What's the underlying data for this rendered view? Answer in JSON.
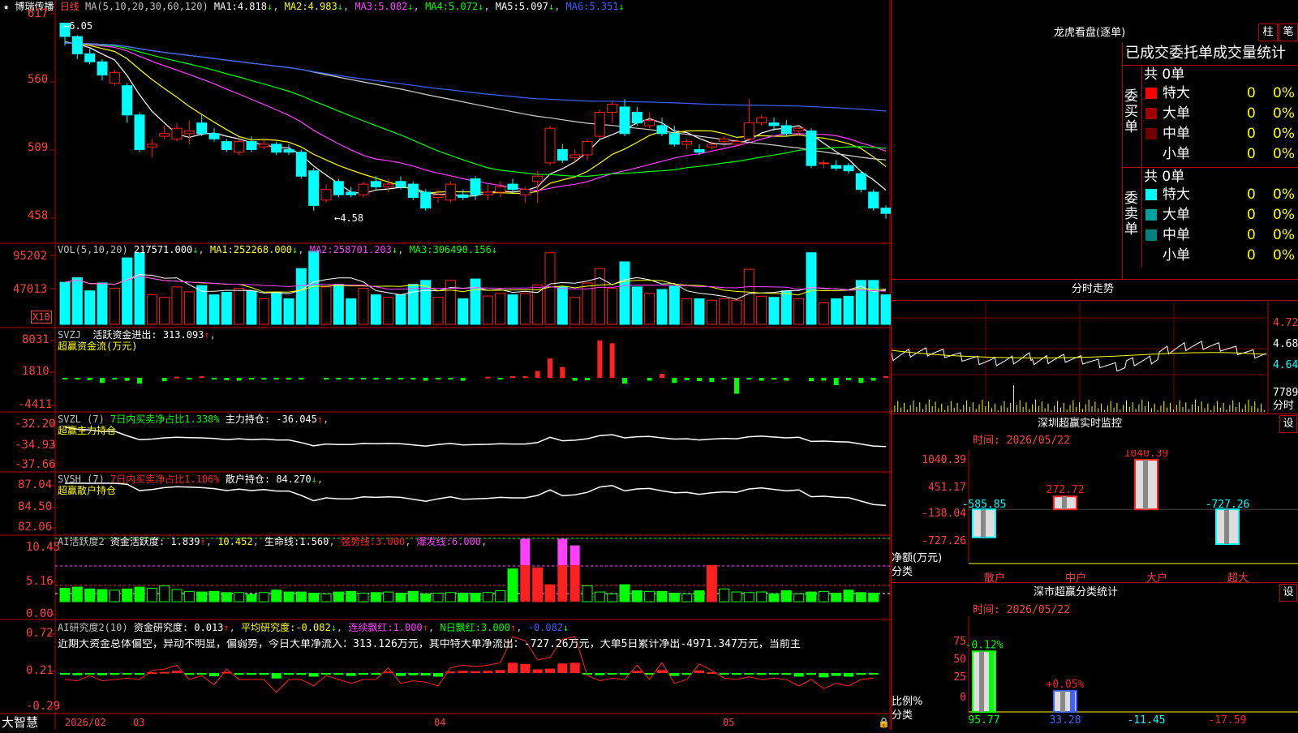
{
  "colors": {
    "up": "#ff2020",
    "down": "#00ffff",
    "frame": "#c00000",
    "yellow": "#ffff00",
    "magenta": "#ff40ff",
    "green": "#00ff00",
    "white": "#ffffff",
    "gray": "#c0c0c0",
    "blue": "#4060ff",
    "label": "#ff4040"
  },
  "price_panel": {
    "name": "博瑞传播",
    "period": "日线",
    "ma_spec": "MA(5,10,20,30,60,120)",
    "ma_values": [
      {
        "label": "MA1:",
        "value": "4.818"
      },
      {
        "label": "MA2:",
        "value": "4.983"
      },
      {
        "label": "MA3:",
        "value": "5.082"
      },
      {
        "label": "MA4:",
        "value": "5.072"
      },
      {
        "label": "MA5:",
        "value": "5.097"
      },
      {
        "label": "MA6:",
        "value": "5.351"
      }
    ],
    "axis_labels": [
      "617",
      "560",
      "509",
      "458"
    ],
    "high_mark": "6.05",
    "low_mark": "4.58"
  },
  "vol_panel": {
    "spec": "VOL(5,10,20)",
    "value": "217571.000",
    "ma": [
      {
        "label": "MA1:",
        "value": "252268.000"
      },
      {
        "label": "MA2:",
        "value": "258701.203"
      },
      {
        "label": "MA3:",
        "value": "306490.156"
      }
    ],
    "axis_labels": [
      "95202",
      "47013"
    ],
    "unit": "X10"
  },
  "svzj_panel": {
    "spec": "SVZJ",
    "label": "活跃资金进出:",
    "value": "313.093",
    "subtitle": "超赢资金流(万元)",
    "axis_labels": [
      "8031",
      "1810",
      "-4411"
    ]
  },
  "svzl_panel": {
    "spec": "SVZL (7)",
    "ratio_text": "7日内买卖净占比1.338%",
    "label": "主力持仓:",
    "value": "-36.045",
    "subtitle": "超赢主力持仓",
    "axis_labels": [
      "-32.20",
      "-34.93",
      "-37.66"
    ]
  },
  "svsh_panel": {
    "spec": "SVSH (7)",
    "ratio_text": "7日内买卖净占比1.106%",
    "label": "散户持仓:",
    "value": "84.270",
    "subtitle": "超赢散户持仓",
    "axis_labels": [
      "87.04",
      "84.50",
      "82.06"
    ]
  },
  "ai_panel": {
    "spec": "AI活跃度2",
    "label": "资金活跃度:",
    "value": "1.839",
    "v2": "10.452",
    "life_label": "生命线:",
    "life_value": "1.560",
    "strong_label": "强势线:",
    "strong_value": "3.000",
    "burst_label": "爆发线:",
    "burst_value": "6.000",
    "axis_labels": [
      "10.45",
      "5.16",
      "0.00"
    ]
  },
  "ai_research": {
    "spec": "AI研究度2(10)",
    "label": "资金研究度:",
    "value": "0.013",
    "avg_label": "平均研究度:",
    "avg_value": "-0.082",
    "cont_label": "连续飘红:",
    "cont_value": "1.000",
    "n_label": "N日飘红:",
    "n_value": "3.000",
    "last_value": "-0.082",
    "summary": "近期大资金总体偏空，异动不明显，偏弱势，今日大单净流入：313.126万元，其中特大单净流出：-727.26万元，大单5日累计净出-4971.347万元，当前主",
    "axis_labels": [
      "0.72",
      "0.21",
      "-0.29"
    ]
  },
  "bottom_axis": {
    "brand": "大智慧",
    "dates": [
      "2026/02",
      "03",
      "04",
      "05"
    ]
  },
  "right": {
    "dragon_title": "龙虎看盘(逐单)",
    "tab_zhu": "柱",
    "tab_bi": "笔",
    "stats_title": "已成交委托单成交量统计",
    "buy_side": "委买单",
    "sell_side": "委卖单",
    "buy_total": "共 0单",
    "sell_total": "共 0单",
    "buy_rows": [
      {
        "label": "特大",
        "count": "0",
        "pct": "0%",
        "color": "#ff0000"
      },
      {
        "label": "大单",
        "count": "0",
        "pct": "0%",
        "color": "#a00000"
      },
      {
        "label": "中单",
        "count": "0",
        "pct": "0%",
        "color": "#700000"
      },
      {
        "label": "小单",
        "count": "0",
        "pct": "0%",
        "color": "#000000"
      }
    ],
    "sell_rows": [
      {
        "label": "特大",
        "count": "0",
        "pct": "0%",
        "color": "#00ffff"
      },
      {
        "label": "大单",
        "count": "0",
        "pct": "0%",
        "color": "#00a0a0"
      },
      {
        "label": "中单",
        "count": "0",
        "pct": "0%",
        "color": "#008080"
      },
      {
        "label": "小单",
        "count": "0",
        "pct": "0%",
        "color": "#000000"
      }
    ],
    "intraday_title": "分时走势",
    "intraday_prices": [
      "4.720",
      "4.680",
      "4.640"
    ],
    "intraday_vol": "7789",
    "intraday_vol_label": "分时",
    "monitor_title": "深圳超赢实时监控",
    "monitor_btn": "设",
    "monitor_time": "时间: 2026/05/22",
    "monitor_axis": [
      "1040.39",
      "451.17",
      "-138.04",
      "-727.26"
    ],
    "monitor_net_label": "净额(万元)",
    "monitor_cat_label": "分类",
    "monitor_bars": [
      {
        "cat": "散户",
        "value": -585.85,
        "label": "-585.85"
      },
      {
        "cat": "中户",
        "value": 272.72,
        "label": "272.72"
      },
      {
        "cat": "大户",
        "value": 1040.39,
        "label": "1040.39"
      },
      {
        "cat": "超大",
        "value": -727.26,
        "label": "-727.26"
      }
    ],
    "stats2_title": "深市超赢分类统计",
    "stats2_btn": "设",
    "stats2_time": "时间: 2026/05/22",
    "stats2_axis": [
      "75",
      "50",
      "25",
      "0"
    ],
    "stats2_ratio_label": "比例%",
    "stats2_cat_label": "分类",
    "stats2_bars": [
      {
        "cat": "散户",
        "pct": 95.77,
        "change": "-0.12%",
        "value": "95.77"
      },
      {
        "cat": "中户",
        "pct": 33.28,
        "change": "+0.05%",
        "value": "33.28"
      },
      {
        "cat": "大户",
        "pct": 0,
        "change": "",
        "value": "-11.45"
      },
      {
        "cat": "超大",
        "pct": 0,
        "change": "",
        "value": "-17.59"
      }
    ]
  },
  "chart_data": {
    "type": "candlestick",
    "ohlc": [
      [
        6.05,
        6.05,
        5.88,
        5.95
      ],
      [
        5.95,
        5.96,
        5.78,
        5.82
      ],
      [
        5.82,
        5.86,
        5.74,
        5.76
      ],
      [
        5.76,
        5.78,
        5.62,
        5.66
      ],
      [
        5.6,
        5.7,
        5.58,
        5.68
      ],
      [
        5.58,
        5.6,
        5.3,
        5.36
      ],
      [
        5.36,
        5.38,
        5.08,
        5.1
      ],
      [
        5.12,
        5.18,
        5.04,
        5.14
      ],
      [
        5.2,
        5.28,
        5.18,
        5.22
      ],
      [
        5.18,
        5.3,
        5.16,
        5.26
      ],
      [
        5.22,
        5.32,
        5.14,
        5.24
      ],
      [
        5.3,
        5.36,
        5.2,
        5.22
      ],
      [
        5.22,
        5.26,
        5.16,
        5.18
      ],
      [
        5.16,
        5.18,
        5.08,
        5.1
      ],
      [
        5.08,
        5.18,
        5.06,
        5.16
      ],
      [
        5.16,
        5.2,
        5.08,
        5.1
      ],
      [
        5.12,
        5.18,
        5.1,
        5.14
      ],
      [
        5.14,
        5.16,
        5.06,
        5.08
      ],
      [
        5.1,
        5.14,
        5.06,
        5.08
      ],
      [
        5.08,
        5.1,
        4.88,
        4.9
      ],
      [
        4.94,
        4.96,
        4.64,
        4.68
      ],
      [
        4.72,
        4.84,
        4.7,
        4.8
      ],
      [
        4.86,
        4.88,
        4.74,
        4.76
      ],
      [
        4.78,
        4.82,
        4.74,
        4.76
      ],
      [
        4.76,
        4.86,
        4.74,
        4.84
      ],
      [
        4.86,
        4.9,
        4.8,
        4.82
      ],
      [
        4.82,
        4.88,
        4.78,
        4.84
      ],
      [
        4.86,
        4.9,
        4.8,
        4.82
      ],
      [
        4.84,
        4.86,
        4.72,
        4.74
      ],
      [
        4.78,
        4.8,
        4.64,
        4.66
      ],
      [
        4.74,
        4.8,
        4.7,
        4.76
      ],
      [
        4.72,
        4.86,
        4.7,
        4.84
      ],
      [
        4.76,
        4.8,
        4.72,
        4.74
      ],
      [
        4.88,
        4.9,
        4.72,
        4.76
      ],
      [
        4.76,
        4.84,
        4.72,
        4.78
      ],
      [
        4.78,
        4.86,
        4.74,
        4.82
      ],
      [
        4.84,
        4.88,
        4.78,
        4.8
      ],
      [
        4.76,
        4.82,
        4.7,
        4.8
      ],
      [
        4.86,
        4.94,
        4.7,
        4.9
      ],
      [
        5.0,
        5.28,
        4.98,
        5.26
      ],
      [
        5.1,
        5.14,
        5.0,
        5.02
      ],
      [
        5.04,
        5.1,
        5.0,
        5.06
      ],
      [
        5.06,
        5.18,
        5.02,
        5.16
      ],
      [
        5.2,
        5.4,
        5.18,
        5.38
      ],
      [
        5.38,
        5.46,
        5.3,
        5.44
      ],
      [
        5.42,
        5.48,
        5.2,
        5.22
      ],
      [
        5.38,
        5.42,
        5.28,
        5.3
      ],
      [
        5.28,
        5.38,
        5.26,
        5.32
      ],
      [
        5.28,
        5.34,
        5.2,
        5.22
      ],
      [
        5.22,
        5.28,
        5.12,
        5.14
      ],
      [
        5.14,
        5.18,
        5.1,
        5.16
      ],
      [
        5.1,
        5.14,
        5.06,
        5.08
      ],
      [
        5.12,
        5.16,
        5.1,
        5.14
      ],
      [
        5.16,
        5.2,
        5.12,
        5.18
      ],
      [
        5.14,
        5.18,
        5.12,
        5.16
      ],
      [
        5.18,
        5.48,
        5.16,
        5.3
      ],
      [
        5.3,
        5.36,
        5.28,
        5.34
      ],
      [
        5.3,
        5.34,
        5.24,
        5.28
      ],
      [
        5.28,
        5.32,
        5.2,
        5.22
      ],
      [
        5.24,
        5.28,
        5.2,
        5.26
      ],
      [
        5.24,
        5.26,
        4.96,
        4.98
      ],
      [
        5.0,
        5.02,
        4.96,
        5.0
      ],
      [
        4.98,
        5.02,
        4.94,
        4.96
      ],
      [
        4.98,
        5.0,
        4.92,
        4.94
      ],
      [
        4.92,
        4.94,
        4.78,
        4.8
      ],
      [
        4.78,
        4.8,
        4.64,
        4.66
      ],
      [
        4.66,
        4.68,
        4.58,
        4.62
      ]
    ],
    "price_range": [
      4.42,
      6.2
    ],
    "svzj": [
      -0.2,
      -0.2,
      -0.4,
      -0.9,
      -0.2,
      -0.5,
      -1.0,
      -0.6,
      0.2,
      -0.2,
      0.3,
      -0.2,
      -0.4,
      -0.5,
      -0.3,
      -0.3,
      -0.2,
      -0.3,
      -0.3,
      -0.3,
      -0.3,
      -0.3,
      -0.2,
      -0.3,
      -0.3,
      -0.3,
      -0.3,
      -0.5,
      -0.2,
      -0.2,
      -0.5,
      0.2,
      -0.3,
      0.3,
      0.3,
      1.2,
      3.4,
      1.9,
      -0.5,
      -0.4,
      6.6,
      6.1,
      -1.0,
      -0.5,
      0.7,
      -0.9,
      -0.4,
      -0.6,
      -0.7,
      -0.3,
      -2.8,
      -0.3,
      -0.5,
      -0.3,
      -0.5,
      -0.6,
      -0.5,
      -1.3,
      -0.4,
      -0.9,
      -0.5,
      0.3
    ],
    "ai_strength": [
      2.2,
      2.4,
      2.1,
      2.0,
      1.9,
      2.1,
      2.4,
      2.2,
      2.6,
      2.0,
      1.7,
      1.6,
      1.7,
      1.5,
      1.5,
      1.2,
      1.5,
      1.9,
      1.6,
      1.6,
      1.4,
      1.3,
      1.6,
      1.7,
      1.4,
      1.5,
      1.6,
      1.4,
      1.7,
      1.3,
      1.4,
      1.5,
      1.4,
      1.4,
      1.5,
      1.8,
      5.4,
      10.4,
      5.6,
      2.8,
      10.4,
      9.3,
      2.6,
      1.6,
      1.3,
      2.8,
      1.8,
      1.7,
      1.7,
      1.4,
      1.3,
      1.8,
      6.0,
      2.1,
      1.6,
      1.5,
      1.6,
      1.3,
      1.8,
      1.3,
      1.6,
      1.7,
      1.4,
      1.9,
      1.5,
      1.4
    ],
    "ai_research": [
      -0.05,
      -0.06,
      -0.02,
      -0.06,
      -0.05,
      -0.04,
      -0.05,
      0.02,
      0.03,
      0.06,
      -0.05,
      -0.02,
      -0.09,
      0.03,
      -0.05,
      -0.05,
      -0.05,
      -0.15,
      -0.05,
      -0.05,
      -0.1,
      -0.02,
      -0.05,
      -0.08,
      -0.05,
      -0.05,
      0.04,
      -0.08,
      -0.06,
      -0.07,
      -0.1,
      0.04,
      0.06,
      0.05,
      0.06,
      0.08,
      0.28,
      0.25,
      0.1,
      0.12,
      0.26,
      0.28,
      -0.02,
      -0.06,
      -0.04,
      -0.05,
      0.06,
      -0.05,
      0.08,
      -0.08,
      -0.05,
      0.07,
      0.02,
      -0.04,
      -0.05,
      -0.03,
      -0.05,
      -0.04,
      -0.05,
      -0.1,
      -0.05,
      -0.12,
      -0.08,
      -0.1,
      -0.05,
      -0.04
    ]
  }
}
